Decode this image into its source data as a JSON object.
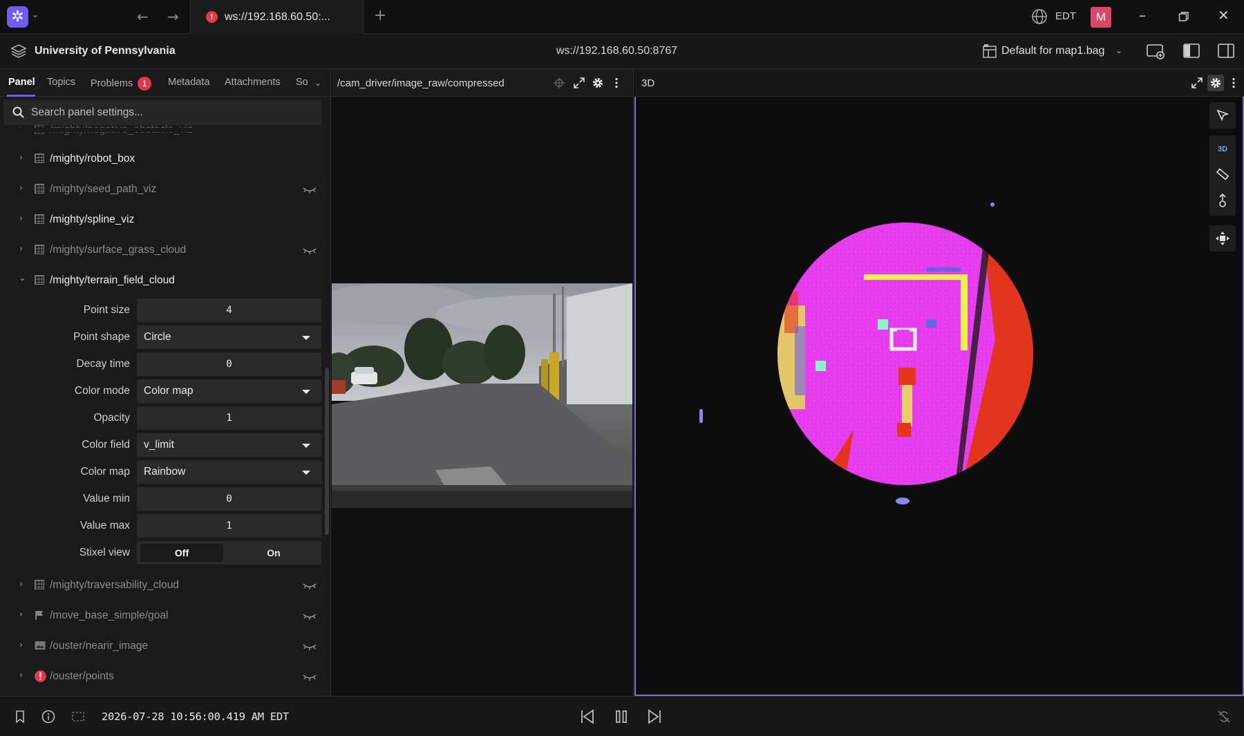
{
  "titlebar": {
    "tab_title": "ws://192.168.60.50:...",
    "tab_status": "!",
    "timezone": "EDT",
    "avatar_letter": "M"
  },
  "toolbar": {
    "organization": "University of Pennsylvania",
    "connection_url": "ws://192.168.60.50:8767",
    "layout_name": "Default for map1.bag"
  },
  "sidebar": {
    "tabs": [
      "Panel",
      "Topics",
      "Problems",
      "Metadata",
      "Attachments",
      "So"
    ],
    "problems_count": "1",
    "search_placeholder": "Search panel settings...",
    "topics_top": [
      {
        "name": "/mighty/negative_obstacle_viz",
        "visible": false
      },
      {
        "name": "/mighty/robot_box",
        "visible": true
      },
      {
        "name": "/mighty/seed_path_viz",
        "visible": false
      },
      {
        "name": "/mighty/spline_viz",
        "visible": true
      },
      {
        "name": "/mighty/surface_grass_cloud",
        "visible": false
      },
      {
        "name": "/mighty/terrain_field_cloud",
        "visible": true,
        "expanded": true
      }
    ],
    "settings": {
      "point_size": {
        "label": "Point size",
        "value": "4"
      },
      "point_shape": {
        "label": "Point shape",
        "value": "Circle"
      },
      "decay_time": {
        "label": "Decay time",
        "value": "0"
      },
      "color_mode": {
        "label": "Color mode",
        "value": "Color map"
      },
      "opacity": {
        "label": "Opacity",
        "value": "1"
      },
      "color_field": {
        "label": "Color field",
        "value": "v_limit"
      },
      "color_map": {
        "label": "Color map",
        "value": "Rainbow"
      },
      "value_min": {
        "label": "Value min",
        "value": "0"
      },
      "value_max": {
        "label": "Value max",
        "value": "1"
      },
      "stixel_view": {
        "label": "Stixel view",
        "off": "Off",
        "on": "On",
        "selected": "Off"
      }
    },
    "topics_bottom": [
      {
        "name": "/mighty/traversability_cloud",
        "icon": "grid-icon"
      },
      {
        "name": "/move_base_simple/goal",
        "icon": "flag-icon"
      },
      {
        "name": "/ouster/nearir_image",
        "icon": "image-icon"
      },
      {
        "name": "/ouster/points",
        "icon": "error-icon"
      }
    ]
  },
  "image_panel": {
    "title": "/cam_driver/image_raw/compressed"
  },
  "panel_3d": {
    "title": "3D",
    "mode_label": "3D"
  },
  "playback": {
    "timestamp": "2026-07-28 10:56:00.419 AM EDT"
  },
  "colors": {
    "accent": "#6f5bf0",
    "error": "#e0394f",
    "magenta_cloud": "#e83ef0",
    "red_cloud": "#e3341e"
  }
}
